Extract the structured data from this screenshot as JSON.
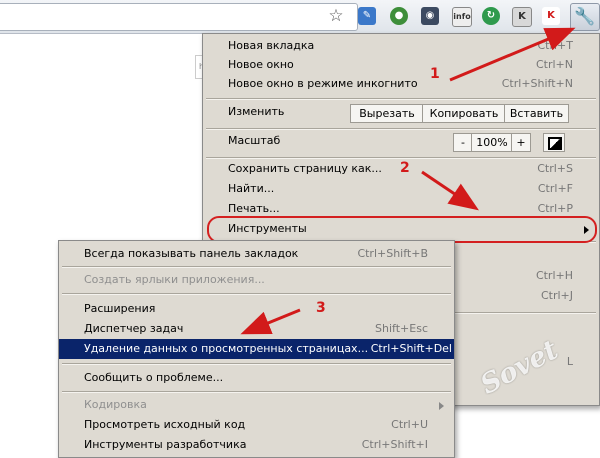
{
  "main_menu": {
    "items": [
      {
        "label": "Новая вкладка",
        "shortcut": "Ctrl+T"
      },
      {
        "label": "Новое окно",
        "shortcut": "Ctrl+N"
      },
      {
        "label": "Новое окно в режиме инкогнито",
        "shortcut": "Ctrl+Shift+N"
      }
    ],
    "edit": {
      "label": "Изменить",
      "cut": "Вырезать",
      "copy": "Копировать",
      "paste": "Вставить"
    },
    "zoom": {
      "label": "Масштаб",
      "minus": "-",
      "value": "100%",
      "plus": "+"
    },
    "items2": [
      {
        "label": "Сохранить страницу как...",
        "shortcut": "Ctrl+S"
      },
      {
        "label": "Найти...",
        "shortcut": "Ctrl+F"
      },
      {
        "label": "Печать...",
        "shortcut": "Ctrl+P"
      },
      {
        "label": "Инструменты",
        "shortcut": ""
      }
    ],
    "hidden_shortcuts": [
      "Ctrl+H",
      "Ctrl+J",
      "L"
    ]
  },
  "submenu": {
    "items": [
      {
        "label": "Всегда показывать панель закладок",
        "shortcut": "Ctrl+Shift+B"
      },
      {
        "label": "Создать ярлыки приложения...",
        "shortcut": ""
      },
      {
        "label": "Расширения",
        "shortcut": ""
      },
      {
        "label": "Диспетчер задач",
        "shortcut": "Shift+Esc"
      },
      {
        "label": "Удаление данных о просмотренных страницах...",
        "shortcut": "Ctrl+Shift+Del"
      },
      {
        "label": "Сообщить о проблеме...",
        "shortcut": ""
      },
      {
        "label": "Кодировка",
        "shortcut": ""
      },
      {
        "label": "Просмотреть исходный код",
        "shortcut": "Ctrl+U"
      },
      {
        "label": "Инструменты разработчика",
        "shortcut": "Ctrl+Shift+I"
      }
    ]
  },
  "annotations": {
    "n1": "1",
    "n2": "2",
    "n3": "3"
  },
  "watermark": "Sovet",
  "toolbar": {
    "star": "☆",
    "wrench": "🔧",
    "page_input_text": "ha"
  },
  "colors": {
    "highlight": "#0a246a",
    "annotation": "#d21a1a",
    "menu_bg": "#dedad2"
  }
}
